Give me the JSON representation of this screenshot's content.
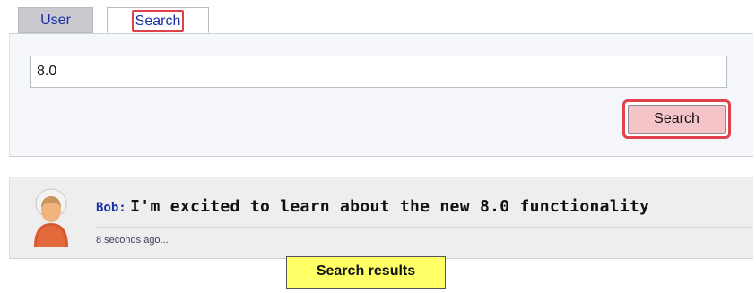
{
  "tabs": [
    {
      "label": "User",
      "active": false
    },
    {
      "label": "Search",
      "active": true,
      "highlighted": true
    }
  ],
  "search": {
    "input_value": "8.0",
    "button_label": "Search"
  },
  "results": [
    {
      "author": "Bob:",
      "text": "I'm excited to learn about the new 8.0 functionality",
      "timestamp": "8 seconds ago..."
    }
  ],
  "callout": {
    "text": "Search results"
  },
  "colors": {
    "tab_text": "#1a2fa6",
    "highlight_red": "#e2424b",
    "button_fill": "#f4c4c8",
    "callout_yellow": "#ffff66",
    "panel_bg": "#f4f6fa",
    "results_bg": "#eeeeef"
  },
  "icons": {
    "avatar": "user-avatar-icon"
  }
}
